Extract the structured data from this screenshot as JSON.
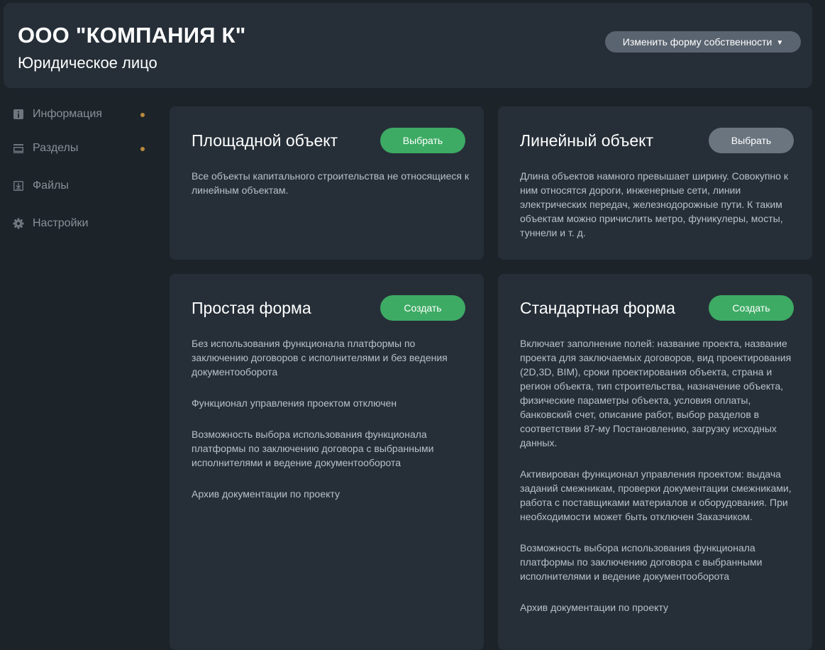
{
  "header": {
    "company_name": "ООО \"КОМПАНИЯ К\"",
    "company_type": "Юридическое лицо",
    "change_ownership_label": "Изменить форму собственности",
    "caret_icon": "caret-down-icon"
  },
  "sidebar": {
    "items": [
      {
        "label": "Информация",
        "icon": "info-icon",
        "dot": true
      },
      {
        "label": "Разделы",
        "icon": "sections-icon",
        "dot": true
      },
      {
        "label": "Файлы",
        "icon": "file-download-icon",
        "dot": false
      },
      {
        "label": "Настройки",
        "icon": "gear-icon",
        "dot": false
      }
    ],
    "dot_color": "#b88a3c"
  },
  "cards": {
    "area_object": {
      "title": "Площадной объект",
      "button": "Выбрать",
      "body": [
        "Все объекты капитального строительства не относящиеся к линейным объектам."
      ]
    },
    "linear_object": {
      "title": "Линейный объект",
      "button": "Выбрать",
      "body": [
        "Длина объектов намного превышает ширину. Совокупно к ним относятся дороги, инженерные сети, линии электрических передач, железнодорожные пути. К таким объектам можно причислить метро, фуникулеры, мосты, туннели и т. д."
      ]
    },
    "simple_form": {
      "title": "Простая форма",
      "button": "Создать",
      "body": [
        "Без использования функционала платформы по заключению договоров с исполнителями и без ведения документооборота",
        "Функционал управления проектом отключен",
        "Возможность выбора использования функционала платформы по заключению договора с выбранными исполнителями и ведение документооборота",
        "Архив документации по проекту"
      ]
    },
    "standard_form": {
      "title": "Стандартная форма",
      "button": "Создать",
      "body": [
        "Включает заполнение полей: название проекта, название проекта для заключаемых договоров, вид проектирования (2D,3D, BIM), сроки проектирования объекта, страна и регион объекта, тип строительства, назначение объекта, физические параметры объекта, условия оплаты, банковский счет, описание работ, выбор разделов в соответствии 87-му Постановлению, загрузку исходных данных.",
        "Активирован функционал управления проектом: выдача заданий смежникам, проверки документации смежниками, работа с поставщиками материалов и оборудования. При необходимости может быть отключен Заказчиком.",
        "Возможность выбора использования функционала платформы по заключению договора с выбранными исполнителями и ведение документооборота",
        "Архив документации по проекту"
      ]
    }
  },
  "colors": {
    "background": "#1c2329",
    "panel": "#262f38",
    "green_button": "#3dab64",
    "gray_button": "#6a7580",
    "ownership_button": "#5a6470",
    "body_text": "#b8c0c8",
    "nav_text": "#8a9097"
  }
}
